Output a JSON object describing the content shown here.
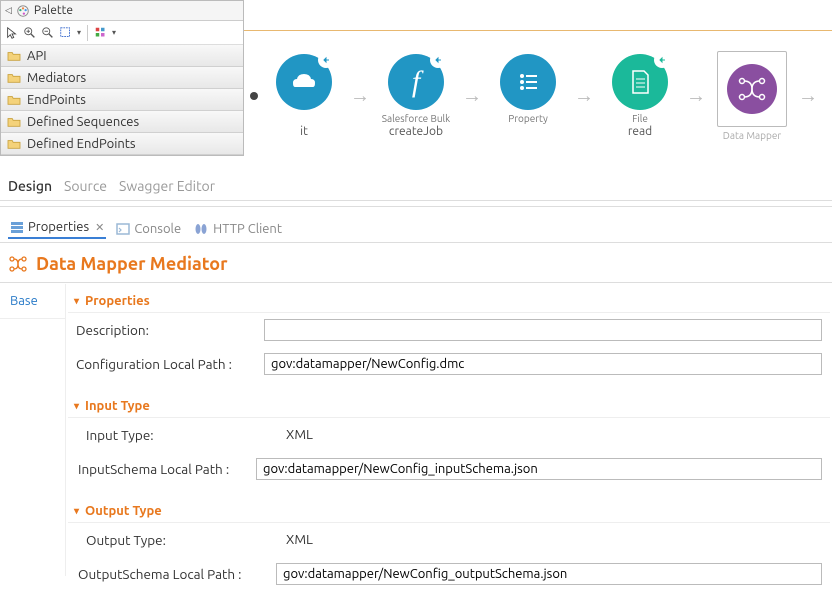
{
  "palette": {
    "title": "Palette",
    "items": [
      "API",
      "Mediators",
      "EndPoints",
      "Defined Sequences",
      "Defined EndPoints"
    ]
  },
  "editor_tabs": {
    "design": "Design",
    "source": "Source",
    "swagger": "Swagger Editor"
  },
  "nodes": {
    "n0_sub": "it",
    "n1_label": "Salesforce Bulk",
    "n1_sub": "createJob",
    "n2_label": "Property",
    "n3_label": "File",
    "n3_sub": "read",
    "n4_label": "Data Mapper"
  },
  "views": {
    "properties": "Properties",
    "console": "Console",
    "http": "HTTP Client"
  },
  "panel": {
    "title": "Data Mapper Mediator",
    "nav_base": "Base",
    "sec_properties": "Properties",
    "lbl_description": "Description:",
    "lbl_config_path": "Configuration Local Path :",
    "val_config_path": "gov:datamapper/NewConfig.dmc",
    "sec_input": "Input Type",
    "lbl_input_type": "Input Type:",
    "val_input_type": "XML",
    "lbl_input_schema": "InputSchema Local Path :",
    "val_input_schema": "gov:datamapper/NewConfig_inputSchema.json",
    "sec_output": "Output Type",
    "lbl_output_type": "Output Type:",
    "val_output_type": "XML",
    "lbl_output_schema": "OutputSchema Local Path :",
    "val_output_schema": "gov:datamapper/NewConfig_outputSchema.json"
  }
}
